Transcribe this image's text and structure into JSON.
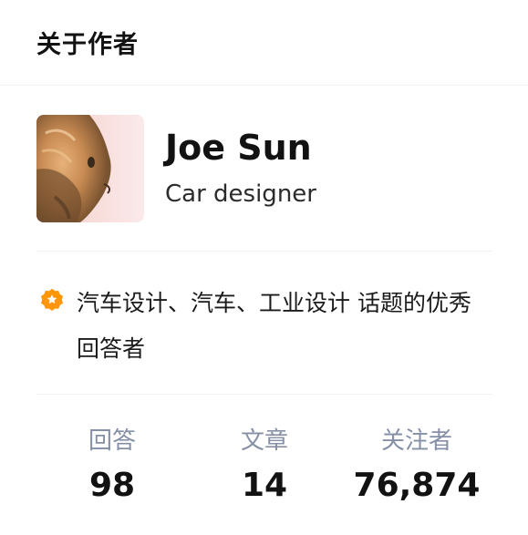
{
  "header": {
    "title": "关于作者"
  },
  "author": {
    "name": "Joe Sun",
    "headline": "Car designer",
    "avatar_icon": "cat-photo-avatar"
  },
  "achievement": {
    "icon": "star-badge-icon",
    "icon_color": "#ff9607",
    "text": "汽车设计、汽车、工业设计 话题的优秀回答者"
  },
  "stats": [
    {
      "label": "回答",
      "value": "98"
    },
    {
      "label": "文章",
      "value": "14"
    },
    {
      "label": "关注者",
      "value": "76,874"
    }
  ]
}
